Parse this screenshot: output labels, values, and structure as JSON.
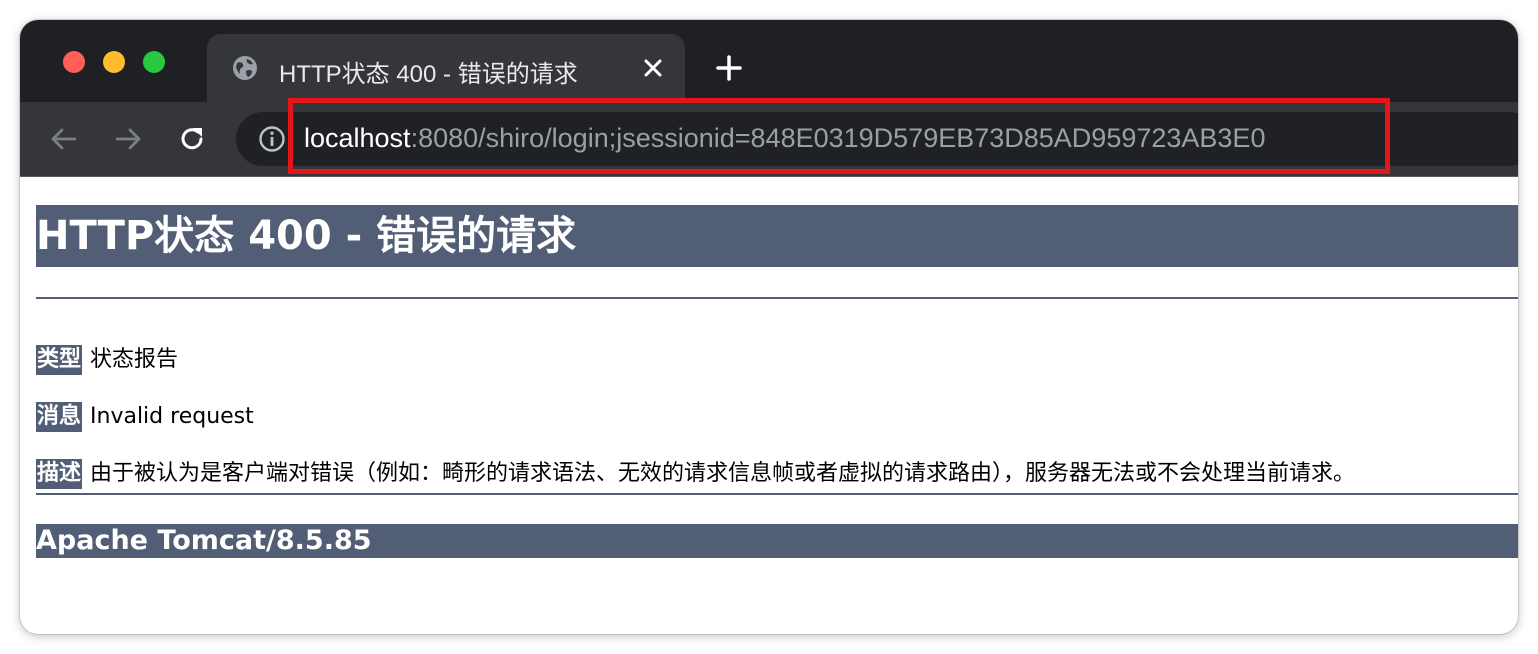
{
  "browser": {
    "tab": {
      "title": "HTTP状态 400 - 错误的请求",
      "icon": "globe-icon"
    },
    "new_tab_icon": "plus-icon",
    "nav": {
      "back_icon": "arrow-left-icon",
      "forward_icon": "arrow-right-icon",
      "reload_icon": "reload-icon"
    },
    "address_bar": {
      "info_icon": "info-icon",
      "url_host": "localhost",
      "url_rest": ":8080/shiro/login;jsessionid=848E0319D579EB73D85AD959723AB3E0"
    },
    "highlight_color": "#e8141b"
  },
  "page": {
    "heading": "HTTP状态 400 - 错误的请求",
    "rows": [
      {
        "label": "类型",
        "value": "状态报告"
      },
      {
        "label": "消息",
        "value": "Invalid request"
      },
      {
        "label": "描述",
        "value": "由于被认为是客户端对错误（例如：畸形的请求语法、无效的请求信息帧或者虚拟的请求路由），服务器无法或不会处理当前请求。"
      }
    ],
    "footer": "Apache Tomcat/8.5.85",
    "accent_color": "#525d76"
  }
}
